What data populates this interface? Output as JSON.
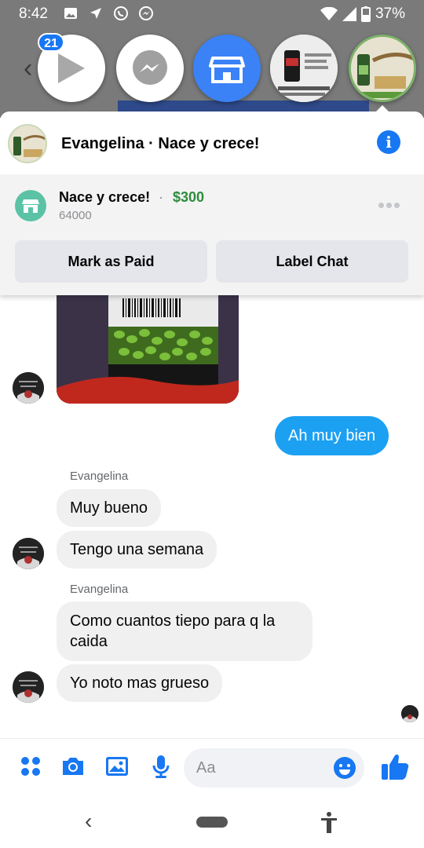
{
  "status_bar": {
    "time": "8:42",
    "battery": "37%"
  },
  "chat_heads": {
    "unread_badge": "21"
  },
  "card": {
    "title": "Evangelina · Nace y crece!",
    "order": {
      "product": "Nace y crece!",
      "separator": "·",
      "price": "$300",
      "zip": "64000"
    },
    "buttons": {
      "mark_paid": "Mark as Paid",
      "label_chat": "Label Chat"
    }
  },
  "messages": {
    "outgoing_1": "Ah muy bien",
    "sender_1": "Evangelina",
    "incoming_1": "Muy bueno",
    "incoming_2": "Tengo una semana",
    "sender_2": "Evangelina",
    "incoming_3": "Como cuantos tiepo para q la caida",
    "incoming_4": "Yo noto mas grueso"
  },
  "composer": {
    "placeholder": "Aa"
  },
  "colors": {
    "messenger_blue": "#1877f2",
    "outgoing_bubble": "#1ca0f2",
    "incoming_bubble": "#f0f0f0",
    "price_green": "#2e8b3d",
    "shop_icon_teal": "#5bc2a6"
  },
  "icons": {
    "composer": [
      "apps-icon",
      "camera-icon",
      "gallery-icon",
      "mic-icon",
      "emoji-icon",
      "thumbs-up-icon"
    ],
    "nav": [
      "back-icon",
      "home-icon",
      "accessibility-icon"
    ]
  }
}
